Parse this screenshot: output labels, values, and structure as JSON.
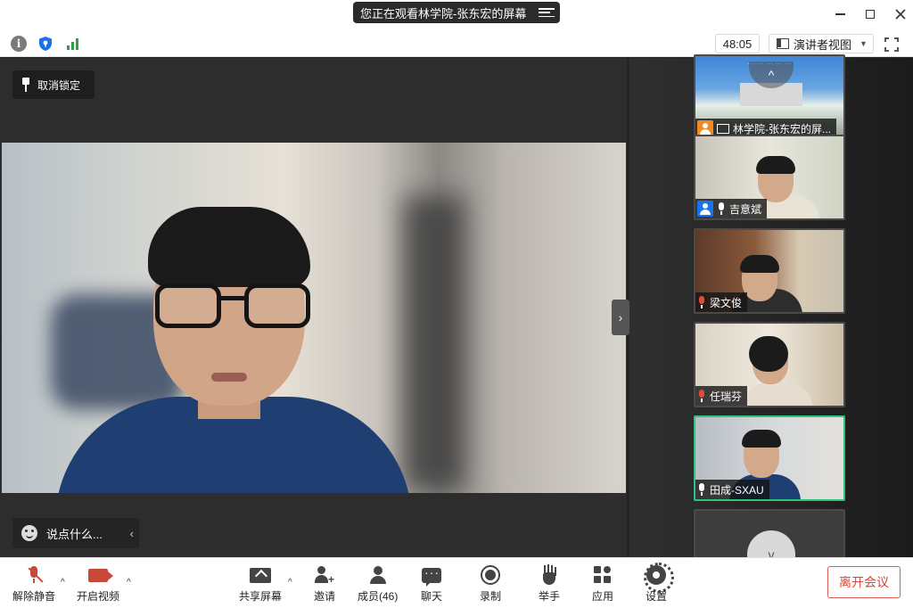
{
  "titlebar": {
    "title": "您正在观看林学院-张东宏的屏幕",
    "menu_icon": "menu-icon"
  },
  "infobar": {
    "timer": "48:05",
    "view_mode": "演讲者视图"
  },
  "main": {
    "unlock_label": "取消锁定",
    "chat_placeholder": "说点什么..."
  },
  "sidebar": {
    "tiles": [
      {
        "name": "林学院-张东宏的屏...",
        "active": false
      },
      {
        "name": "吉意斌",
        "active": false
      },
      {
        "name": "梁文俊",
        "active": false
      },
      {
        "name": "任瑞芬",
        "active": false
      },
      {
        "name": "田成-SXAU",
        "active": true
      }
    ]
  },
  "toolbar": {
    "unmute": "解除静音",
    "start_video": "开启视频",
    "share_screen": "共享屏幕",
    "invite": "邀请",
    "members": "成员(46)",
    "chat": "聊天",
    "record": "录制",
    "raise_hand": "举手",
    "apps": "应用",
    "settings": "设置",
    "leave": "离开会议"
  },
  "colors": {
    "accent_green": "#2ec27e",
    "danger_red": "#d9453b",
    "signal_green": "#2ea043"
  }
}
